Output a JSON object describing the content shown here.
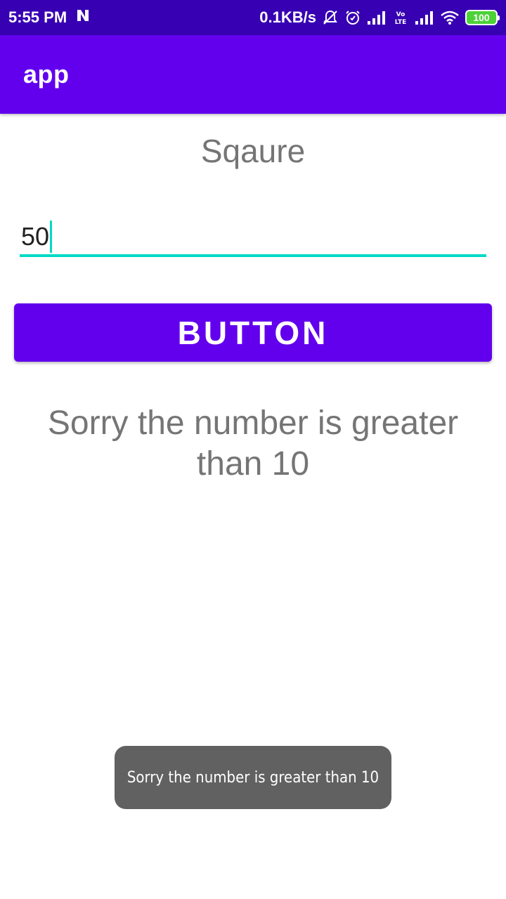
{
  "status_bar": {
    "time": "5:55 PM",
    "network_speed": "0.1KB/s",
    "battery": "100",
    "icons": [
      "n-notification-icon",
      "mute-icon",
      "alarm-icon",
      "signal-icon",
      "volte-icon",
      "signal-icon",
      "wifi-icon",
      "battery-icon"
    ]
  },
  "app_bar": {
    "title": "app"
  },
  "main": {
    "heading": "Sqaure",
    "input_value": "50",
    "button_label": "BUTTON",
    "result_text": "Sorry the number is greater than 10"
  },
  "toast": {
    "message": "Sorry the number is greater than 10"
  },
  "colors": {
    "status_bar": "#3700b3",
    "primary": "#6200ee",
    "accent": "#03dac5",
    "text_secondary": "#757575",
    "toast_bg": "#616161"
  }
}
